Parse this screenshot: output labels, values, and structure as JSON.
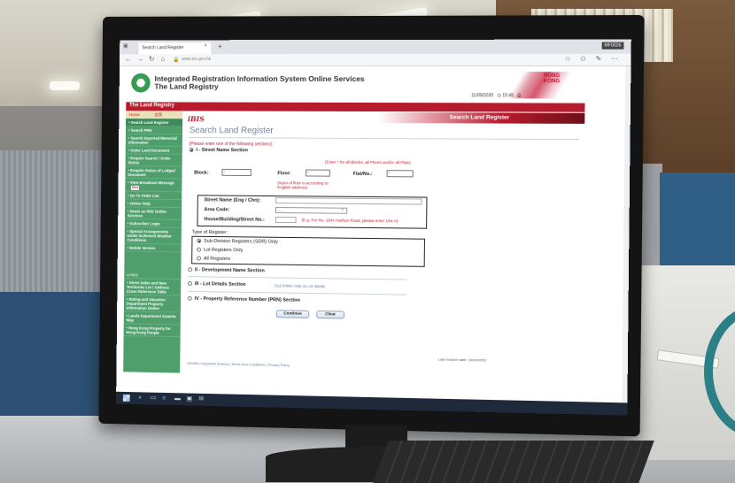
{
  "browser": {
    "tab_title": "Search Land Register",
    "tab_close": "×",
    "new_tab": "+",
    "mf_code": "MF0026",
    "url": "www.iris.gov.hk"
  },
  "header": {
    "title_line1": "Integrated Registration Information System Online Services",
    "title_line2": "The Land Registry",
    "hk_brand_line1": "HONG",
    "hk_brand_line2": "KONG",
    "date": "11/09/2020",
    "time": "15:45"
  },
  "red_bar": {
    "label": "The Land Registry"
  },
  "sidebar": {
    "lang_home": "Home",
    "lang_chinese": "主頁",
    "items": [
      "Search Land Register",
      "Search PRN",
      "Search Imported Memorial Information",
      "Order Land Document",
      "Enquire Search / Order Status",
      "Enquire Status of Lodged Document",
      "View Broadcast Message",
      "Go To Order List",
      "Online Help",
      "Demo on IRIS Online Services",
      "Subscriber Login",
      "Special Arrangements Under Inclement Weather Conditions",
      "Mobile Version"
    ],
    "new_badge": "New",
    "links_heading": "Link(s)",
    "links": [
      "Street Index and New Territories Lot / Address Cross Reference Table",
      "Rating and Valuation Department Property Information Online",
      "Lands Department GeoInfo Map",
      "Hong Kong Property for Hong Kong People"
    ]
  },
  "main": {
    "ibis_logo": "iBIS",
    "banner_text": "Search Land Register",
    "heading": "Search Land Register",
    "instruction": "(Please enter one of the following sections)",
    "section1": "I - Street Name Section",
    "wildcard_note": "(Enter * for all Blocks, all Floors and/or all Flats)",
    "block_label": "Block:",
    "block_value": "*",
    "floor_label": "Floor:",
    "floor_value": "*",
    "flat_label": "Flat/No.:",
    "flat_value": "*",
    "floor_note_line1": "(Input of floor is according to",
    "floor_note_line2": "English address)",
    "street_label": "Street Name (Eng / Chn):",
    "area_label": "Area Code:",
    "area_value": "---",
    "house_label": "House/Building/Street No.:",
    "house_note": "(E.g. For No. 194A Nathan Road, please enter 194-A)",
    "register_type_label": "Type of Register:",
    "register_options": [
      "Sub-Division Registers (SDR) Only",
      "Lot Registers Only",
      "All Registers"
    ],
    "section2": "II - Development Name Section",
    "section3": "III - Lot Details Section",
    "section3_link": "Get Online Help on Lot details",
    "section4": "IV - Property Reference Number (PRN) Section",
    "continue_button": "Continue",
    "clear_button": "Clear",
    "last_revision": "Last revision date: 16/09/2020",
    "footer_links": "100485 | Important Notices | Terms And Conditions | Privacy Policy"
  },
  "monitor": {
    "brand": "ASUS"
  }
}
